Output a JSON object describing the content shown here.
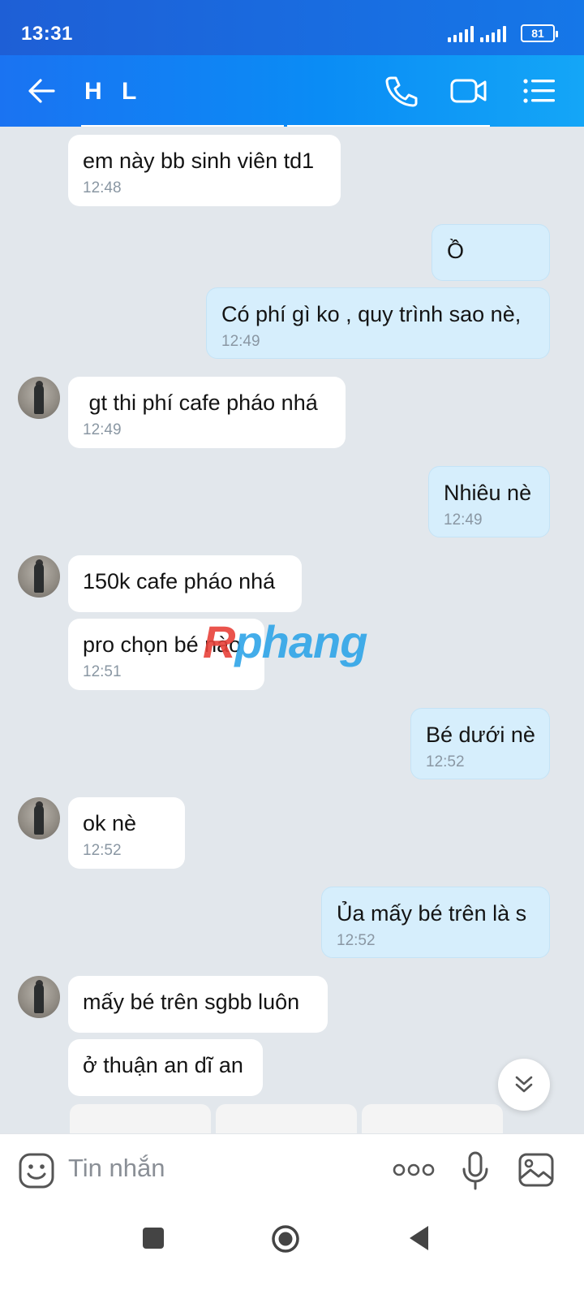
{
  "status_bar": {
    "time": "13:31",
    "battery": "81"
  },
  "header": {
    "title": "H L"
  },
  "messages": [
    {
      "dir": "in",
      "text": "em này bb sinh viên td1",
      "time": "12:48"
    },
    {
      "dir": "out",
      "text": "Ồ",
      "time": ""
    },
    {
      "dir": "out",
      "text": "Có phí gì ko , quy trình sao nè,",
      "time": "12:49"
    },
    {
      "dir": "in",
      "text": " gt thi phí cafe pháo nhá",
      "time": "12:49"
    },
    {
      "dir": "out",
      "text": "Nhiêu nè",
      "time": "12:49"
    },
    {
      "dir": "in",
      "text": "150k cafe pháo nhá",
      "time": ""
    },
    {
      "dir": "in",
      "text": "pro chọn bé nào",
      "time": "12:51"
    },
    {
      "dir": "out",
      "text": "Bé dưới nè",
      "time": "12:52"
    },
    {
      "dir": "in",
      "text": "ok nè",
      "time": "12:52"
    },
    {
      "dir": "out",
      "text": "Ủa mấy bé trên là s",
      "time": "12:52"
    },
    {
      "dir": "in",
      "text": "mấy bé trên sgbb luôn",
      "time": ""
    },
    {
      "dir": "in",
      "text": "ở thuận an dĩ an",
      "time": ""
    }
  ],
  "watermark": {
    "part1": "R",
    "part2": "phang"
  },
  "input": {
    "placeholder": "Tin nhắn"
  },
  "icons": {
    "back": "arrow-left-icon",
    "call": "phone-icon",
    "video": "video-camera-icon",
    "menu": "list-menu-icon",
    "sticker": "smiley-icon",
    "more": "more-dots-icon",
    "mic": "microphone-icon",
    "gallery": "image-icon",
    "scroll": "chevron-double-down-icon"
  }
}
